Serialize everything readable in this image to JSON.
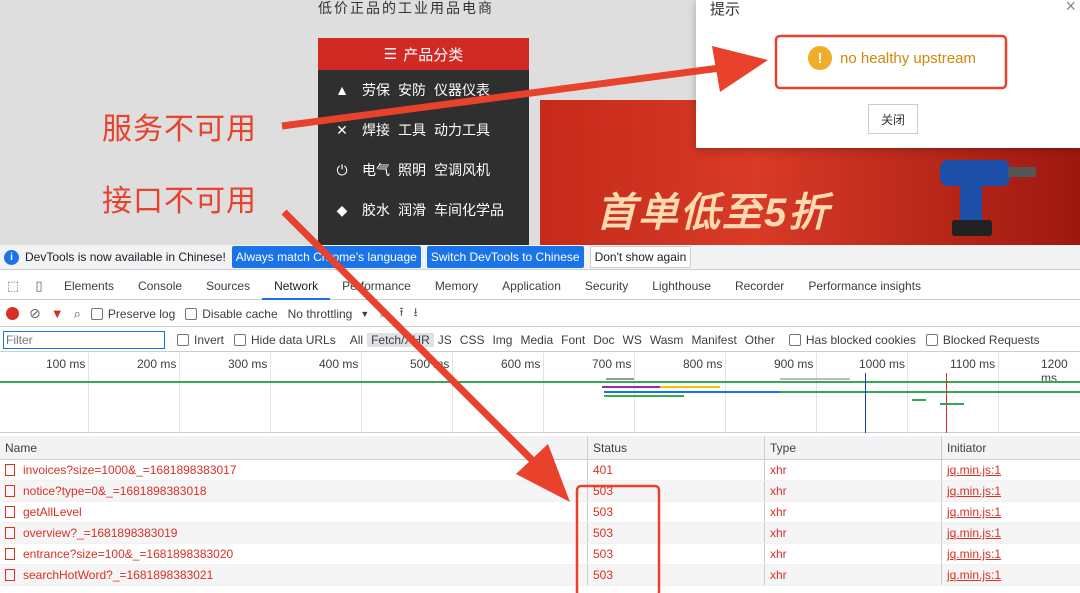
{
  "page": {
    "site_title": "低价正品的工业用品电商",
    "category_header": "产品分类",
    "categories": [
      {
        "icon": "safety-cone-icon",
        "labels": [
          "劳保",
          "安防",
          "仪器仪表"
        ]
      },
      {
        "icon": "tools-icon",
        "labels": [
          "焊接",
          "工具",
          "动力工具"
        ]
      },
      {
        "icon": "plug-icon",
        "labels": [
          "电气",
          "照明",
          "空调风机"
        ]
      },
      {
        "icon": "bottle-icon",
        "labels": [
          "胶水",
          "润滑",
          "车间化学品"
        ]
      }
    ],
    "banner_text": "首单低至5折"
  },
  "dialog": {
    "title": "提示",
    "close": "×",
    "message": "no healthy upstream",
    "ok_label": "关闭"
  },
  "annotations": {
    "service_unavailable": "服务不可用",
    "api_unavailable": "接口不可用",
    "color": "#e8412c"
  },
  "devtools": {
    "infobar": {
      "message": "DevTools is now available in Chinese!",
      "btn_match": "Always match Chrome's language",
      "btn_switch": "Switch DevTools to Chinese",
      "btn_dismiss": "Don't show again"
    },
    "tabs": [
      "Elements",
      "Console",
      "Sources",
      "Network",
      "Performance",
      "Memory",
      "Application",
      "Security",
      "Lighthouse",
      "Recorder",
      "Performance insights"
    ],
    "active_tab": "Network",
    "toolbar": {
      "preserve_log": "Preserve log",
      "disable_cache": "Disable cache",
      "throttling": "No throttling"
    },
    "filterbar": {
      "placeholder": "Filter",
      "invert": "Invert",
      "hide_data_urls": "Hide data URLs",
      "types": [
        "All",
        "Fetch/XHR",
        "JS",
        "CSS",
        "Img",
        "Media",
        "Font",
        "Doc",
        "WS",
        "Wasm",
        "Manifest",
        "Other"
      ],
      "selected_type": "Fetch/XHR",
      "blocked_cookies": "Has blocked cookies",
      "blocked_requests": "Blocked Requests"
    },
    "timeline_ticks": [
      "100 ms",
      "200 ms",
      "300 ms",
      "400 ms",
      "500 ms",
      "600 ms",
      "700 ms",
      "800 ms",
      "900 ms",
      "1000 ms",
      "1100 ms",
      "1200 ms"
    ],
    "columns": {
      "name": "Name",
      "status": "Status",
      "type": "Type",
      "initiator": "Initiator"
    },
    "requests": [
      {
        "name": "invoices?size=1000&_=1681898383017",
        "status": "401",
        "type": "xhr",
        "initiator": "jq.min.js:1"
      },
      {
        "name": "notice?type=0&_=1681898383018",
        "status": "503",
        "type": "xhr",
        "initiator": "jq.min.js:1"
      },
      {
        "name": "getAllLevel",
        "status": "503",
        "type": "xhr",
        "initiator": "jq.min.js:1"
      },
      {
        "name": "overview?_=1681898383019",
        "status": "503",
        "type": "xhr",
        "initiator": "jq.min.js:1"
      },
      {
        "name": "entrance?size=100&_=1681898383020",
        "status": "503",
        "type": "xhr",
        "initiator": "jq.min.js:1"
      },
      {
        "name": "searchHotWord?_=1681898383021",
        "status": "503",
        "type": "xhr",
        "initiator": "jq.min.js:1"
      }
    ]
  }
}
